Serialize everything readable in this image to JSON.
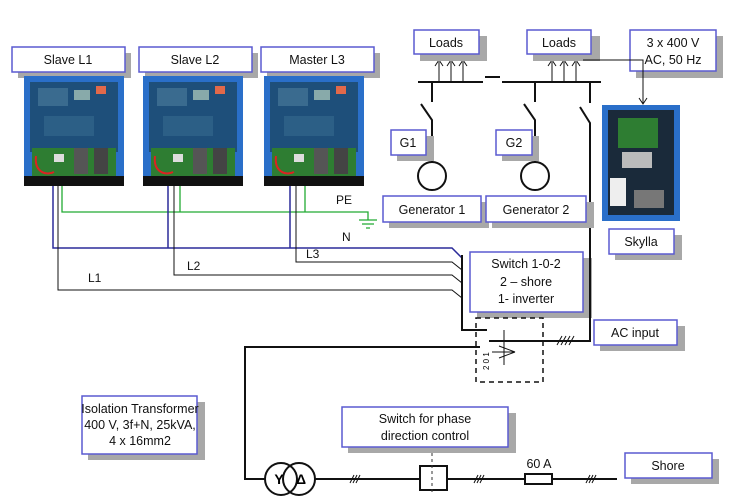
{
  "labels": {
    "slave_l1": "Slave L1",
    "slave_l2": "Slave L2",
    "master_l3": "Master L3",
    "loads_1": "Loads",
    "loads_2": "Loads",
    "supply_line1": "3 x 400 V",
    "supply_line2": "AC,  50 Hz",
    "g1": "G1",
    "g2": "G2",
    "generator_1": "Generator 1",
    "generator_2": "Generator 2",
    "skylla": "Skylla",
    "switch_line1": "Switch 1-0-2",
    "switch_line2": "2 – shore",
    "switch_line3": "1- inverter",
    "ac_input": "AC input",
    "transformer_line1": "Isolation Transformer",
    "transformer_line2": "400 V, 3f+N, 25kVA,",
    "transformer_line3": "4 x 16mm2",
    "phase_switch_line1": "Switch  for phase",
    "phase_switch_line2": "direction control",
    "fuse": "60 A",
    "shore": "Shore",
    "pe": "PE",
    "n": "N",
    "l1": "L1",
    "l2": "L2",
    "l3": "L3",
    "transformer_y": "Y",
    "transformer_delta": "Δ",
    "switch_positions": "2 0 1"
  },
  "colors": {
    "box_border": "#5a5ad0",
    "neutral_wire": "#2b2b9a",
    "pe_wire": "#22aa33",
    "phase_wire": "#111111",
    "inverter_case": "#2a6fc9",
    "pcb": "#1e4f7a"
  }
}
